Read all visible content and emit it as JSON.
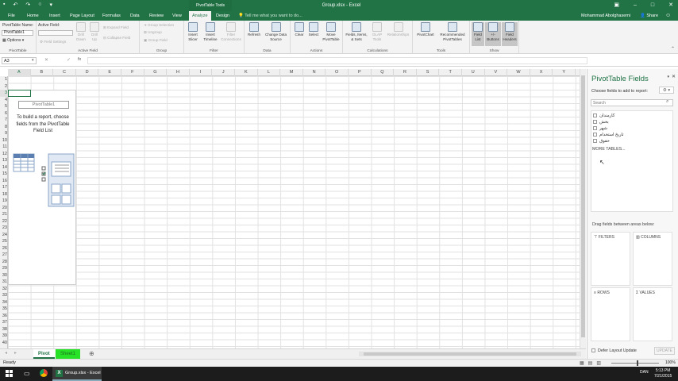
{
  "titlebar": {
    "title": "Group.xlsx - Excel",
    "context_tab": "PivotTable Tools"
  },
  "tabs": {
    "items": [
      "File",
      "Home",
      "Insert",
      "Page Layout",
      "Formulas",
      "Data",
      "Review",
      "View",
      "Analyze",
      "Design"
    ],
    "active": "Analyze",
    "tell_me": "Tell me what you want to do...",
    "user": "Mohammad Abolghasemi",
    "share": "Share"
  },
  "ribbon": {
    "pivottable": {
      "name_label": "PivotTable Name:",
      "name_value": "PivotTable1",
      "options": "Options",
      "group": "PivotTable"
    },
    "active_field": {
      "label": "Active Field:",
      "field_settings": "Field Settings",
      "drill_down": "Drill Down",
      "drill_up": "Drill Up",
      "expand": "Expand Field",
      "collapse": "Collapse Field",
      "group": "Active Field"
    },
    "group": {
      "group_selection": "Group Selection",
      "ungroup": "Ungroup",
      "group_field": "Group Field",
      "group": "Group"
    },
    "filter": {
      "insert_slicer": "Insert Slicer",
      "insert_timeline": "Insert Timeline",
      "filter_connections": "Filter Connections",
      "group": "Filter"
    },
    "data": {
      "refresh": "Refresh",
      "change_source": "Change Data Source",
      "group": "Data"
    },
    "actions": {
      "clear": "Clear",
      "select": "Select",
      "move": "Move PivotTable",
      "group": "Actions"
    },
    "calculations": {
      "fields_items": "Fields, Items, & Sets",
      "olap": "OLAP Tools",
      "relationships": "Relationships",
      "group": "Calculations"
    },
    "tools": {
      "pivotchart": "PivotChart",
      "recommended": "Recommended PivotTables",
      "group": "Tools"
    },
    "show": {
      "field_list": "Field List",
      "buttons": "+/- Buttons",
      "headers": "Field Headers",
      "group": "Show"
    }
  },
  "formula_bar": {
    "name_box": "A3",
    "fx": "fx"
  },
  "grid": {
    "columns": [
      "A",
      "B",
      "C",
      "D",
      "E",
      "F",
      "G",
      "H",
      "I",
      "J",
      "K",
      "L",
      "M",
      "N",
      "O",
      "P",
      "Q",
      "R",
      "S",
      "T",
      "U",
      "V",
      "W",
      "X",
      "Y"
    ],
    "rows": [
      "1",
      "2",
      "3",
      "4",
      "5",
      "6",
      "7",
      "8",
      "9",
      "10",
      "11",
      "12",
      "13",
      "14",
      "15",
      "16",
      "17",
      "18",
      "19",
      "20",
      "21",
      "22",
      "23",
      "24",
      "25",
      "26",
      "27",
      "28",
      "29",
      "30",
      "31",
      "32",
      "33",
      "34",
      "35",
      "36",
      "37",
      "38",
      "39",
      "40"
    ],
    "pivot_name": "PivotTable1",
    "pivot_message": "To build a report, choose fields from the PivotTable Field List"
  },
  "sheets": {
    "items": [
      "Pivot",
      "Sheet1"
    ],
    "active": "Pivot"
  },
  "status": {
    "ready": "Ready",
    "zoom": "100%"
  },
  "field_pane": {
    "title": "PivotTable Fields",
    "choose": "Choose fields to add to report:",
    "search_placeholder": "Search",
    "fields": [
      "کارمندان",
      "بخش",
      "شهر",
      "تاریخ استخدام",
      "حقوق"
    ],
    "more_tables": "MORE TABLES...",
    "drag_hint": "Drag fields between areas below:",
    "areas": [
      "FILTERS",
      "COLUMNS",
      "ROWS",
      "VALUES"
    ],
    "defer": "Defer Layout Update",
    "update": "UPDATE"
  },
  "taskbar": {
    "app_label": "Group.xlsx - Excel",
    "tray_lang": "DAN",
    "time": "5:13 PM",
    "date": "7/21/2015"
  }
}
